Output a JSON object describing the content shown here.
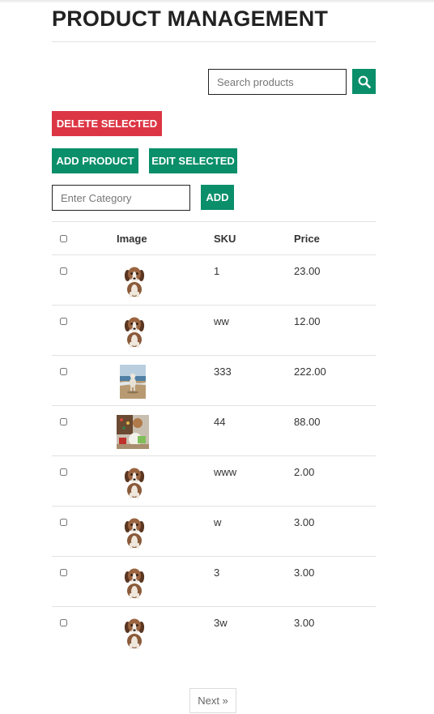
{
  "page_title": "PRODUCT MANAGEMENT",
  "search": {
    "placeholder": "Search products",
    "icon": "search-icon"
  },
  "actions": {
    "delete_label": "DELETE SELECTED",
    "add_product_label": "ADD PRODUCT",
    "edit_selected_label": "EDIT SELECTED",
    "category_placeholder": "Enter Category",
    "add_label": "ADD"
  },
  "colors": {
    "accent": "#0a8f6a",
    "danger": "#dc3645"
  },
  "table": {
    "headers": {
      "image": "Image",
      "sku": "SKU",
      "price": "Price"
    },
    "rows": [
      {
        "image": "puppy",
        "sku": "1",
        "price": "23.00"
      },
      {
        "image": "puppy",
        "sku": "ww",
        "price": "12.00"
      },
      {
        "image": "beach-dog",
        "sku": "333",
        "price": "222.00"
      },
      {
        "image": "christmas-dog",
        "sku": "44",
        "price": "88.00"
      },
      {
        "image": "puppy",
        "sku": "www",
        "price": "2.00"
      },
      {
        "image": "puppy",
        "sku": "w",
        "price": "3.00"
      },
      {
        "image": "puppy",
        "sku": "3",
        "price": "3.00"
      },
      {
        "image": "puppy",
        "sku": "3w",
        "price": "3.00"
      }
    ]
  },
  "pagination": {
    "next_label": "Next »"
  }
}
